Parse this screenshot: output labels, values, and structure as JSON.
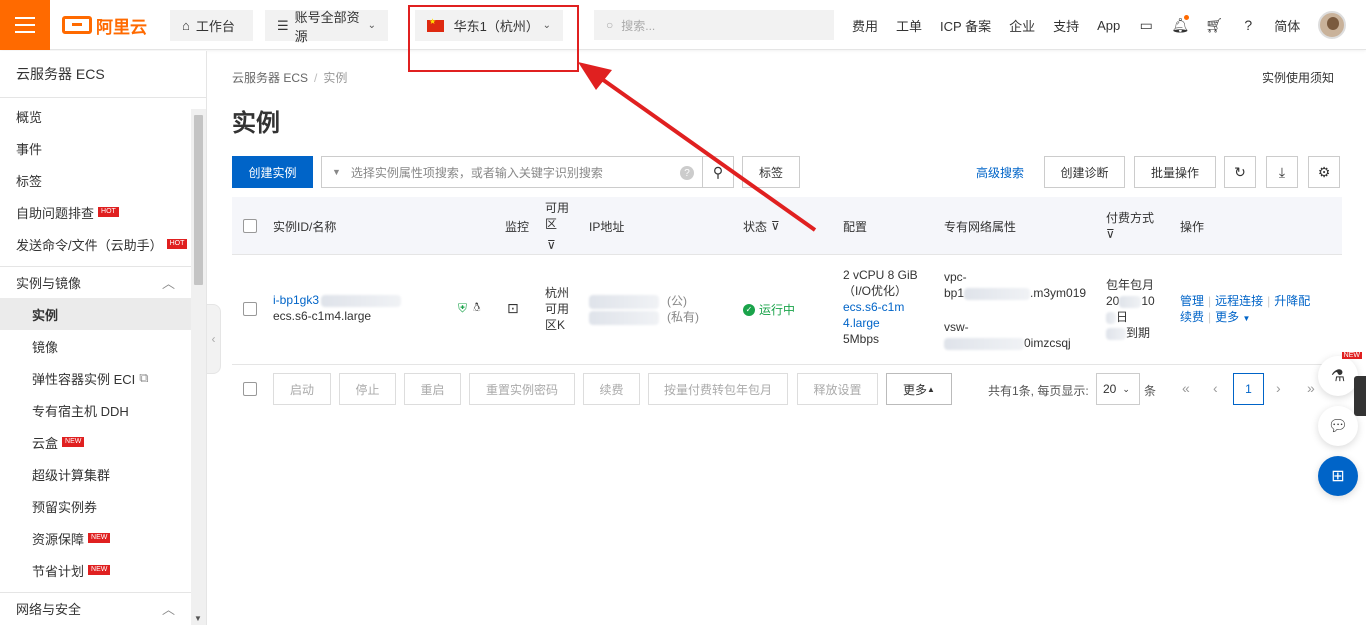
{
  "topbar": {
    "logo_text": "阿里云",
    "workbench": "工作台",
    "resources": "账号全部资源",
    "region": "华东1（杭州）",
    "search_placeholder": "搜索...",
    "links": [
      "费用",
      "工单",
      "ICP 备案",
      "企业",
      "支持",
      "App"
    ],
    "lang": "简体"
  },
  "sidebar": {
    "title": "云服务器 ECS",
    "top_items": [
      {
        "label": "概览"
      },
      {
        "label": "事件"
      },
      {
        "label": "标签"
      },
      {
        "label": "自助问题排查",
        "badge": "HOT"
      },
      {
        "label": "发送命令/文件（云助手）",
        "badge": "HOT"
      }
    ],
    "section1": "实例与镜像",
    "sub_items": [
      {
        "label": "实例"
      },
      {
        "label": "镜像"
      },
      {
        "label": "弹性容器实例 ECI"
      },
      {
        "label": "专有宿主机 DDH"
      },
      {
        "label": "云盒",
        "badge": "NEW"
      },
      {
        "label": "超级计算集群"
      },
      {
        "label": "预留实例券"
      },
      {
        "label": "资源保障",
        "badge": "NEW"
      },
      {
        "label": "节省计划",
        "badge": "NEW"
      }
    ],
    "section2": "网络与安全"
  },
  "main": {
    "breadcrumb": [
      "云服务器 ECS",
      "实例"
    ],
    "notice": "实例使用须知",
    "title": "实例",
    "create_button": "创建实例",
    "search_placeholder": "选择实例属性项搜索，或者输入关键字识别搜索",
    "tag_button": "标签",
    "advanced_search": "高级搜索",
    "diagnose_button": "创建诊断",
    "batch_button": "批量操作",
    "columns": {
      "id": "实例ID/名称",
      "monitor": "监控",
      "zone": "可用区",
      "ip": "IP地址",
      "status": "状态",
      "config": "配置",
      "vpc": "专有网络属性",
      "billing": "付费方式",
      "actions": "操作"
    },
    "row": {
      "id": "i-bp1gk3",
      "type": "ecs.s6-c1m4.large",
      "zone": "杭州可用区K",
      "ip_public": "(公)",
      "ip_private": "(私有)",
      "status": "运行中",
      "config_line1": "2 vCPU 8 GiB",
      "config_line2": "（I/O优化）",
      "config_link": "ecs.s6-c1m4.large",
      "bandwidth": "5Mbps",
      "vpc_prefix": "vpc-",
      "vpc_line2_prefix": "bp1",
      "vpc_line2_suffix": ".m3ym019",
      "vsw_prefix": "vsw-",
      "vsw_suffix": "0imzcsqj",
      "billing_type": "包年包月",
      "billing_date_prefix": "20",
      "billing_date_suffix": "10",
      "billing_day": "日",
      "billing_expire": "到期",
      "action_manage": "管理",
      "action_remote": "远程连接",
      "action_resize": "升降配",
      "action_renew": "续费",
      "action_more": "更多"
    },
    "footer": {
      "buttons": [
        "启动",
        "停止",
        "重启",
        "重置实例密码",
        "续费",
        "按量付费转包年包月",
        "释放设置",
        "更多"
      ],
      "total_text": "共有1条, 每页显示:",
      "page_size": "20",
      "unit": "条",
      "current_page": "1"
    }
  }
}
